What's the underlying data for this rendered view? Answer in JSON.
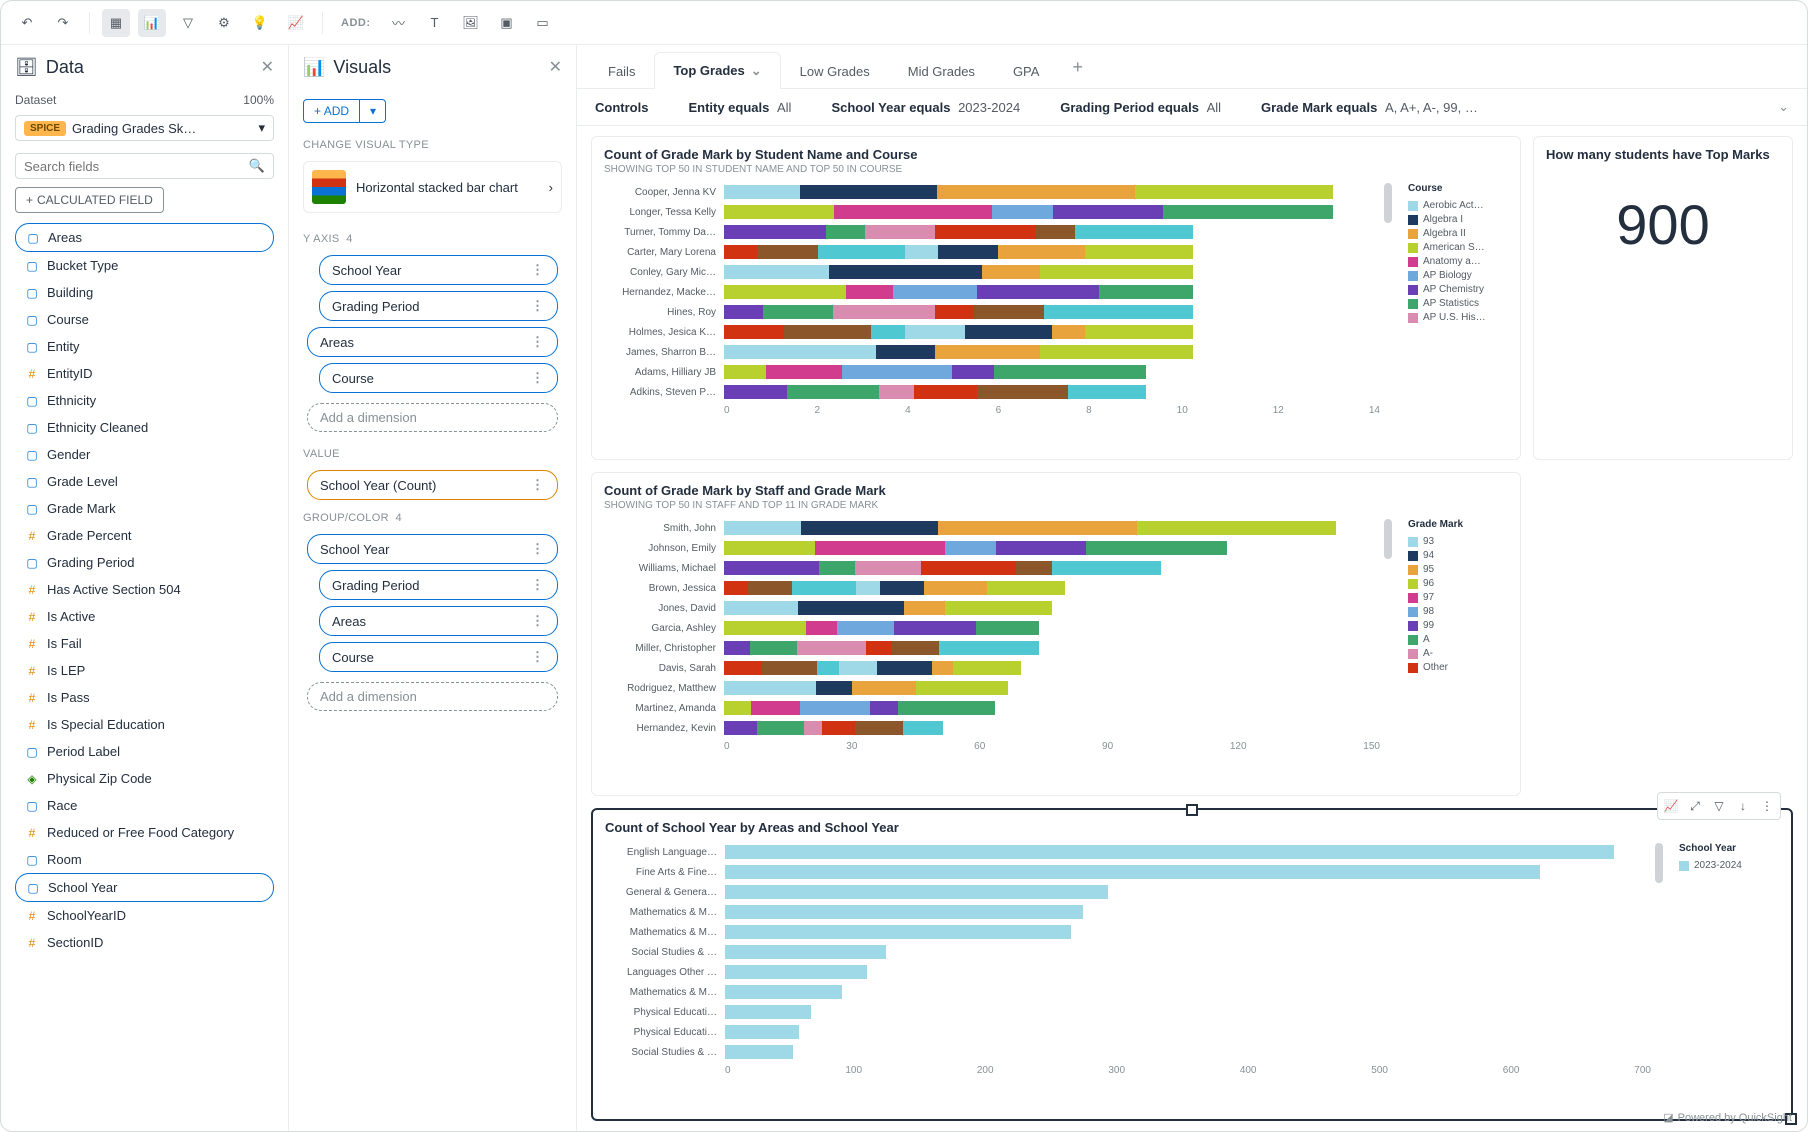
{
  "toolbar": {
    "add_label": "ADD:"
  },
  "data_panel": {
    "title": "Data",
    "dataset_label": "Dataset",
    "dataset_pct": "100%",
    "spice": "SPICE",
    "dataset_name": "Grading Grades Sk…",
    "search_placeholder": "Search fields",
    "calc_btn": "CALCULATED FIELD",
    "fields": [
      {
        "name": "Areas",
        "type": "dim",
        "pill": true
      },
      {
        "name": "Bucket Type",
        "type": "dim"
      },
      {
        "name": "Building",
        "type": "dim"
      },
      {
        "name": "Course",
        "type": "dim"
      },
      {
        "name": "Entity",
        "type": "dim"
      },
      {
        "name": "EntityID",
        "type": "num"
      },
      {
        "name": "Ethnicity",
        "type": "dim"
      },
      {
        "name": "Ethnicity Cleaned",
        "type": "dim"
      },
      {
        "name": "Gender",
        "type": "dim"
      },
      {
        "name": "Grade Level",
        "type": "dim"
      },
      {
        "name": "Grade Mark",
        "type": "dim"
      },
      {
        "name": "Grade Percent",
        "type": "num"
      },
      {
        "name": "Grading Period",
        "type": "dim"
      },
      {
        "name": "Has Active Section 504",
        "type": "num"
      },
      {
        "name": "Is Active",
        "type": "num"
      },
      {
        "name": "Is Fail",
        "type": "num"
      },
      {
        "name": "Is LEP",
        "type": "num"
      },
      {
        "name": "Is Pass",
        "type": "num"
      },
      {
        "name": "Is Special Education",
        "type": "num"
      },
      {
        "name": "Period Label",
        "type": "dim"
      },
      {
        "name": "Physical Zip Code",
        "type": "geo"
      },
      {
        "name": "Race",
        "type": "dim"
      },
      {
        "name": "Reduced or Free Food Category",
        "type": "num"
      },
      {
        "name": "Room",
        "type": "dim"
      },
      {
        "name": "School Year",
        "type": "dim",
        "pill": true
      },
      {
        "name": "SchoolYearID",
        "type": "num"
      },
      {
        "name": "SectionID",
        "type": "num"
      }
    ]
  },
  "visuals_panel": {
    "title": "Visuals",
    "add_label": "ADD",
    "change_type_label": "CHANGE VISUAL TYPE",
    "visual_type": "Horizontal stacked bar chart",
    "yaxis_label": "Y AXIS",
    "yaxis_count": "4",
    "yaxis_fields": [
      {
        "name": "School Year",
        "nested": true
      },
      {
        "name": "Grading Period",
        "nested": true
      },
      {
        "name": "Areas",
        "nested": false
      },
      {
        "name": "Course",
        "nested": true
      }
    ],
    "add_dim": "Add a dimension",
    "value_label": "VALUE",
    "value_field": "School Year (Count)",
    "group_label": "GROUP/COLOR",
    "group_count": "4",
    "group_fields": [
      {
        "name": "School Year",
        "nested": false
      },
      {
        "name": "Grading Period",
        "nested": true
      },
      {
        "name": "Areas",
        "nested": true
      },
      {
        "name": "Course",
        "nested": true
      }
    ]
  },
  "tabs": [
    "Fails",
    "Top Grades",
    "Low Grades",
    "Mid Grades",
    "GPA"
  ],
  "active_tab": 1,
  "controls": {
    "label": "Controls",
    "items": [
      {
        "name": "Entity equals",
        "value": "All"
      },
      {
        "name": "School Year equals",
        "value": "2023-2024"
      },
      {
        "name": "Grading Period equals",
        "value": "All"
      },
      {
        "name": "Grade Mark equals",
        "value": "A, A+, A-, 99, …"
      }
    ]
  },
  "kpi": {
    "title": "How many students have Top Marks",
    "value": "900"
  },
  "chart_data": [
    {
      "type": "bar",
      "title": "Count of Grade Mark by Student Name and Course",
      "subtitle": "SHOWING TOP 50 IN STUDENT NAME AND TOP 50 IN COURSE",
      "x_ticks": [
        0,
        2,
        4,
        6,
        8,
        10,
        12,
        14
      ],
      "xlim": [
        0,
        14
      ],
      "legend_title": "Course",
      "legend": [
        "Aerobic Act…",
        "Algebra I",
        "Algebra II",
        "American S…",
        "Anatomy a…",
        "AP Biology",
        "AP Chemistry",
        "AP Statistics",
        "AP U.S. His…"
      ],
      "legend_colors": [
        "#9fd9e8",
        "#1f3a5f",
        "#e8a33d",
        "#b8d12f",
        "#d13c8f",
        "#6fa8dc",
        "#6a3fb5",
        "#3fa66b",
        "#d98bb0"
      ],
      "categories": [
        "Cooper, Jenna KV",
        "Longer, Tessa Kelly",
        "Turner, Tommy Da…",
        "Carter, Mary Lorena",
        "Conley, Gary Mic…",
        "Hernandez, Macke…",
        "Hines, Roy",
        "Holmes, Jesica K…",
        "James, Sharron B…",
        "Adams, Hilliary JB",
        "Adkins, Steven P…"
      ],
      "values": [
        13,
        13,
        10,
        10,
        10,
        10,
        10,
        10,
        10,
        9,
        9
      ]
    },
    {
      "type": "bar",
      "title": "Count of Grade Mark by Staff and Grade Mark",
      "subtitle": "SHOWING TOP 50 IN STAFF AND TOP 11 IN GRADE MARK",
      "x_ticks": [
        0,
        30,
        60,
        90,
        120,
        150
      ],
      "xlim": [
        0,
        150
      ],
      "legend_title": "Grade Mark",
      "legend": [
        "93",
        "94",
        "95",
        "96",
        "97",
        "98",
        "99",
        "A",
        "A-",
        "Other"
      ],
      "legend_colors": [
        "#9fd9e8",
        "#1f3a5f",
        "#e8a33d",
        "#b8d12f",
        "#d13c8f",
        "#6fa8dc",
        "#6a3fb5",
        "#3fa66b",
        "#d98bb0",
        "#d13212"
      ],
      "categories": [
        "Smith, John",
        "Johnson, Emily",
        "Williams, Michael",
        "Brown, Jessica",
        "Jones, David",
        "Garcia, Ashley",
        "Miller, Christopher",
        "Davis, Sarah",
        "Rodriguez, Matthew",
        "Martinez, Amanda",
        "Hernandez, Kevin"
      ],
      "values": [
        140,
        115,
        100,
        78,
        75,
        72,
        72,
        68,
        65,
        62,
        50
      ]
    },
    {
      "type": "bar",
      "title": "Count of School Year by Areas and School Year",
      "x_ticks": [
        0,
        100,
        200,
        300,
        400,
        500,
        600,
        700
      ],
      "xlim": [
        0,
        750
      ],
      "legend_title": "School Year",
      "legend": [
        "2023-2024"
      ],
      "legend_colors": [
        "#9fd9e8"
      ],
      "categories": [
        "English Language…",
        "Fine Arts & Fine…",
        "General & Genera…",
        "Mathematics & M…",
        "Mathematics & M…",
        "Social Studies & …",
        "Languages Other …",
        "Mathematics & M…",
        "Physical Educati…",
        "Physical Educati…",
        "Social Studies & …"
      ],
      "values": [
        720,
        660,
        310,
        290,
        280,
        130,
        115,
        95,
        70,
        60,
        55
      ]
    }
  ],
  "colors_stack1": [
    "#9fd9e8",
    "#1f3a5f",
    "#e8a33d",
    "#b8d12f",
    "#d13c8f",
    "#6fa8dc",
    "#6a3fb5",
    "#3fa66b",
    "#d98bb0",
    "#d13212",
    "#8b572a",
    "#50c8d1"
  ],
  "footer": "Powered by QuickSight"
}
